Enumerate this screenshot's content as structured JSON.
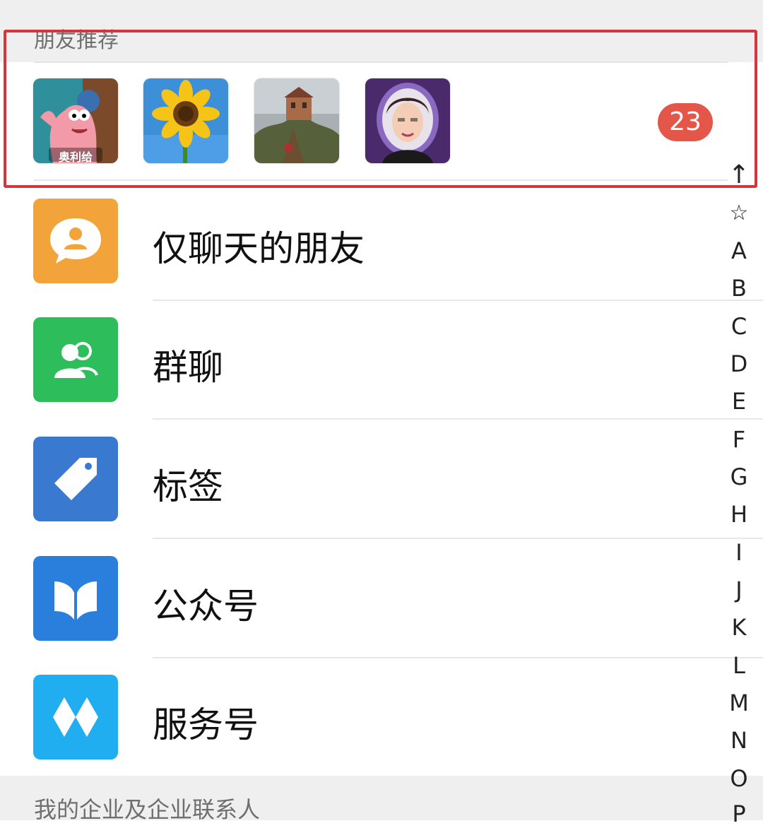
{
  "recommend": {
    "header": "朋友推荐",
    "avatars": [
      {
        "name": "patrick-avatar",
        "caption": "奥利给"
      },
      {
        "name": "sunflower-avatar"
      },
      {
        "name": "landscape-avatar"
      },
      {
        "name": "portrait-avatar"
      }
    ],
    "count": "23"
  },
  "entries": [
    {
      "label": "仅聊天的朋友",
      "icon": "chat-person-icon",
      "color": "#f2a33a"
    },
    {
      "label": "群聊",
      "icon": "group-icon",
      "color": "#2dbd5a"
    },
    {
      "label": "标签",
      "icon": "tag-icon",
      "color": "#3a79d0"
    },
    {
      "label": "公众号",
      "icon": "official-account-icon",
      "color": "#2b7fdc"
    },
    {
      "label": "服务号",
      "icon": "service-account-icon",
      "color": "#21aef0"
    }
  ],
  "bottom_header": "我的企业及企业联系人",
  "index": {
    "up_arrow": "↑",
    "star": "☆",
    "letters": [
      "A",
      "B",
      "C",
      "D",
      "E",
      "F",
      "G",
      "H",
      "I",
      "J",
      "K",
      "L",
      "M",
      "N",
      "O",
      "P"
    ]
  },
  "colors": {
    "highlight": "#d8343d",
    "badge": "#e4564a"
  }
}
